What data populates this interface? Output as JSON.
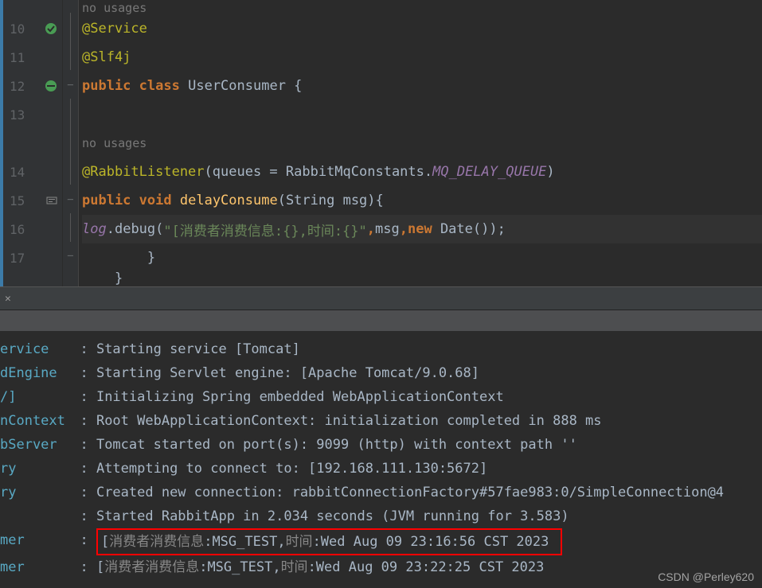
{
  "gutter": {
    "lines": [
      "10",
      "11",
      "12",
      "13",
      "",
      "14",
      "15",
      "16",
      "17",
      ""
    ]
  },
  "editor": {
    "line0_inlay": "no usages",
    "line10": {
      "ann": "@Service"
    },
    "line11": {
      "ann": "@Slf4j"
    },
    "line12": {
      "kw1": "public",
      "kw2": "class",
      "cls": "UserConsumer",
      "brace": " {"
    },
    "line13": "",
    "line13b_inlay": "no usages",
    "line14": {
      "ann": "@RabbitListener",
      "open": "(",
      "param": "queues = RabbitMqConstants.",
      "const": "MQ_DELAY_QUEUE",
      "close": ")"
    },
    "line15": {
      "kw1": "public",
      "kw2": "void",
      "mtd": "delayConsume",
      "sig": "(String msg){"
    },
    "line16": {
      "fld": "log",
      "dot": ".",
      "mtd": "debug",
      "open": "(",
      "str": "\"[消费者消费信息:{},时间:{}\"",
      "c1": ",",
      "arg1": "msg",
      "c2": ",",
      "kw": "new",
      "date": " Date()",
      "close": ");"
    },
    "line17": "        }",
    "line18": "    }"
  },
  "console": {
    "lines": [
      {
        "cls": "ervice",
        "msg": "Starting service [Tomcat]"
      },
      {
        "cls": "dEngine",
        "msg": "Starting Servlet engine: [Apache Tomcat/9.0.68]"
      },
      {
        "cls": "/]",
        "msg": "Initializing Spring embedded WebApplicationContext"
      },
      {
        "cls": "nContext",
        "msg": "Root WebApplicationContext: initialization completed in 888 ms"
      },
      {
        "cls": "bServer",
        "msg": "Tomcat started on port(s): 9099 (http) with context path ''"
      },
      {
        "cls": "ry",
        "msg": "Attempting to connect to: [192.168.111.130:5672]"
      },
      {
        "cls": "ry",
        "msg": "Created new connection: rabbitConnectionFactory#57fae983:0/SimpleConnection@4"
      },
      {
        "cls": "",
        "msg": "Started RabbitApp in 2.034 seconds (JVM running for 3.583)"
      },
      {
        "cls": "mer",
        "msg_pre": "[",
        "msg_grey": "消费者消费信息",
        "msg_post": ":MSG_TEST,",
        "msg_grey2": "时间",
        "msg_post2": ":Wed Aug 09 23:16:56 CST 2023",
        "boxed": true
      },
      {
        "cls": "mer",
        "msg_pre": "[",
        "msg_grey": "消费者消费信息",
        "msg_post": ":MSG_TEST,",
        "msg_grey2": "时间",
        "msg_post2": ":Wed Aug 09 23:22:25 CST 2023",
        "boxed": false
      }
    ]
  },
  "watermark": "CSDN @Perley620"
}
